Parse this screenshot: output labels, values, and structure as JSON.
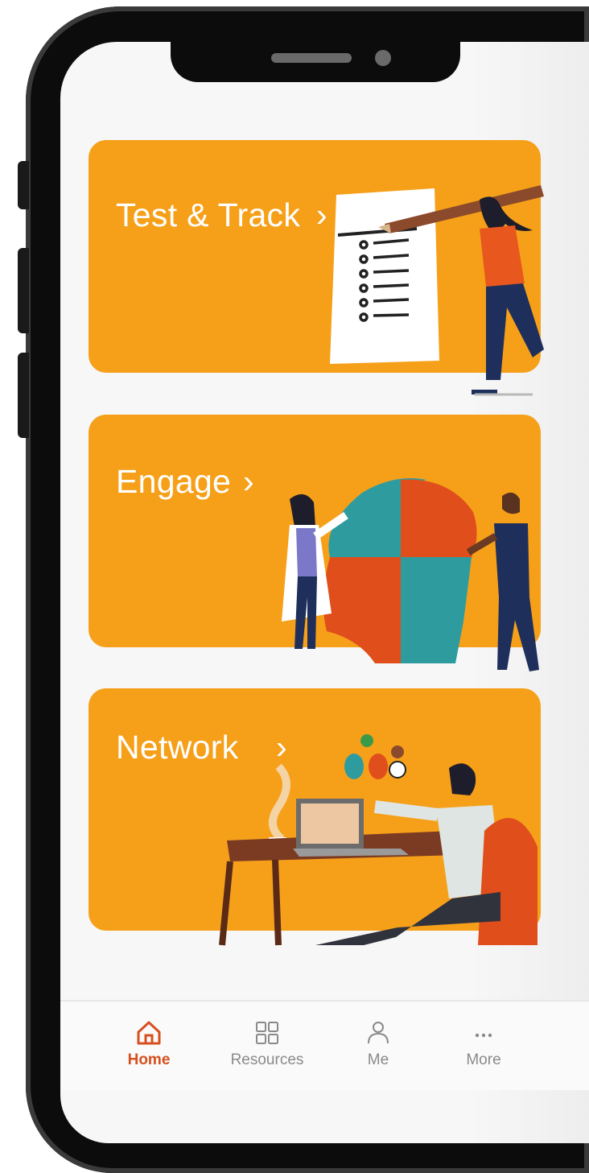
{
  "cards": [
    {
      "title": "Test & Track"
    },
    {
      "title": "Engage"
    },
    {
      "title": "Network"
    }
  ],
  "tabs": [
    {
      "label": "Home",
      "icon": "home-icon",
      "active": true
    },
    {
      "label": "Resources",
      "icon": "grid-icon",
      "active": false
    },
    {
      "label": "Me",
      "icon": "person-icon",
      "active": false
    },
    {
      "label": "More",
      "icon": "more-icon",
      "active": false
    }
  ],
  "colors": {
    "card": "#f6a01a",
    "accent": "#d6501f",
    "tab_inactive": "#8a8a8a",
    "teal": "#2e9c9f",
    "navy": "#1f2f5c"
  }
}
